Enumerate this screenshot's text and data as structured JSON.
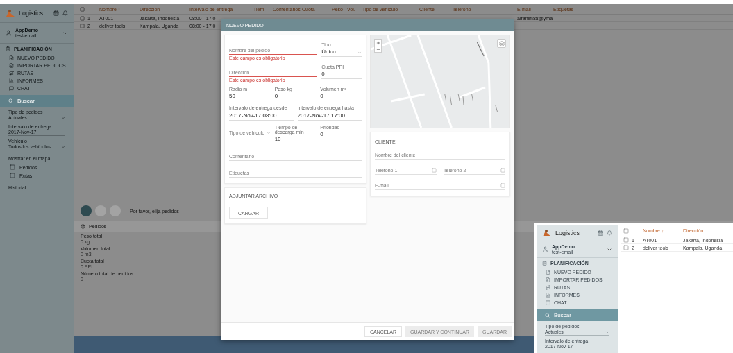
{
  "sidebar": {
    "brand": "Logistics",
    "user": {
      "name": "AppDemo",
      "sub": "test-email"
    },
    "section": "PLANIFICACIÓN",
    "items": [
      {
        "label": "NUEVO PEDIDO"
      },
      {
        "label": "IMPORTAR PEDIDOS"
      },
      {
        "label": "RUTAS"
      },
      {
        "label": "INFORMES"
      },
      {
        "label": "CHAT"
      }
    ],
    "search": "Buscar",
    "filters": [
      {
        "label": "Tipo de pedidos",
        "value": "Actuales",
        "kind": "select"
      },
      {
        "label": "Intervalo de entrega",
        "value": "2017-Nov-17",
        "kind": "date"
      },
      {
        "label": "Vehículo",
        "value": "Todos los vehículos",
        "kind": "select"
      }
    ],
    "map_options": {
      "title": "Mostrar en el mapa",
      "items": [
        {
          "label": "Pedidos",
          "checked": false
        },
        {
          "label": "Rutas",
          "checked": false
        }
      ]
    },
    "link": "Historial"
  },
  "table": {
    "header_checked": false,
    "columns": [
      "Nombre ↑",
      "Dirección",
      "Intervalo de entrega",
      "Tiem",
      "Comentarios",
      "Cuota",
      "Peso",
      "Vol.",
      "Tipo de vehículo",
      "Cliente",
      "Teléfono",
      "E-mail",
      "Etiquetas"
    ],
    "rows": [
      {
        "number": "1",
        "name": "AT001",
        "address": "Jakarta, Indonesia",
        "interval": "08:00 - 17:0",
        "email": "alrahim88@yma",
        "checked": false
      },
      {
        "number": "2",
        "name": "deliver tools",
        "address": "Kampala, Uganda",
        "interval": "08:00 - 17:0",
        "checked": false
      }
    ]
  },
  "steps": [
    {
      "selected": true
    },
    {
      "selected": false
    },
    {
      "selected": false
    }
  ],
  "steps_hint": "Por favor, elija pedidos",
  "panel": {
    "title": "Pedidos",
    "stats": [
      {
        "label": "Peso total",
        "value": "0 kg"
      },
      {
        "label": "Volumen total",
        "value": "0 m3"
      },
      {
        "label": "Cuota total",
        "value": "0 PPI"
      },
      {
        "label": "Número total de pedidos",
        "value": "0"
      }
    ]
  },
  "modal": {
    "title": "NUEVO PEDIDO",
    "rows": [
      {
        "kind": "wide",
        "fields": [
          {
            "kind": "input",
            "placeholder": "Nombre del pedido",
            "error": "Este campo es obligatorio"
          },
          {
            "kind": "select",
            "label": "Tipo",
            "value": "Único"
          }
        ]
      },
      {
        "kind": "wide",
        "fields": [
          {
            "kind": "input",
            "placeholder": "Dirección",
            "error": "Este campo es obligatorio"
          },
          {
            "kind": "input",
            "label": "Cuota PPI",
            "value": "0"
          }
        ]
      },
      {
        "kind": "even",
        "fields": [
          {
            "kind": "input",
            "label": "Radio m",
            "value": "50"
          },
          {
            "kind": "input",
            "label": "Peso kg",
            "value": "0"
          },
          {
            "kind": "input",
            "label": "Volumen m³",
            "value": "0"
          }
        ]
      },
      {
        "kind": "even",
        "fields": [
          {
            "kind": "input",
            "label": "Intervalo de entrega desde",
            "value": "2017-Nov-17 08:00"
          },
          {
            "kind": "input",
            "label": "Intervalo de entrega hasta",
            "value": "2017-Nov-17 17:00"
          }
        ]
      },
      {
        "kind": "even",
        "fields": [
          {
            "kind": "select",
            "placeholder": "Tipo de vehículo"
          },
          {
            "kind": "input",
            "label": "Tiempo de descarga min",
            "value": "10"
          },
          {
            "kind": "input",
            "label": "Prioridad",
            "value": "0"
          }
        ]
      },
      {
        "kind": "even",
        "fields": [
          {
            "kind": "input",
            "placeholder": "Comentario"
          }
        ]
      },
      {
        "kind": "even",
        "fields": [
          {
            "kind": "input",
            "placeholder": "Etiquetas"
          }
        ]
      }
    ],
    "attach": {
      "title": "ADJUNTAR ARCHIVO",
      "button": "CARGAR"
    },
    "client": {
      "title": "CLIENTE",
      "rows": [
        [
          {
            "placeholder": "Nombre del cliente"
          }
        ],
        [
          {
            "placeholder": "Teléfono 1",
            "checked": false
          },
          {
            "placeholder": "Teléfono 2",
            "checked": false
          }
        ],
        [
          {
            "placeholder": "E-mail",
            "checked": false
          }
        ]
      ]
    },
    "buttons": [
      {
        "label": "CANCELAR",
        "disabled": false
      },
      {
        "label": "GUARDAR Y CONTINUAR",
        "disabled": true
      },
      {
        "label": "GUARDAR",
        "disabled": true
      }
    ]
  },
  "inset": {
    "sidebar": {
      "brand": "Logistics",
      "user": {
        "name": "AppDemo",
        "sub": "test-email"
      },
      "section": "PLANIFICACIÓN",
      "items": [
        {
          "label": "NUEVO PEDIDO"
        },
        {
          "label": "IMPORTAR PEDIDOS"
        },
        {
          "label": "RUTAS"
        },
        {
          "label": "INFORMES"
        },
        {
          "label": "CHAT"
        }
      ],
      "search": "Buscar",
      "filters": [
        {
          "label": "Tipo de pedidos",
          "value": "Actuales",
          "kind": "select"
        },
        {
          "label": "Intervalo de entrega",
          "value": "2017-Nov-17",
          "kind": "date"
        }
      ]
    },
    "table": {
      "header_checked": false,
      "columns": [
        "Nombre ↑",
        "Dirección"
      ],
      "rows": [
        {
          "number": "1",
          "name": "AT001",
          "address": "Jakarta, Indonesia",
          "checked": false
        },
        {
          "number": "2",
          "name": "deliver tools",
          "address": "Kampala, Uganda",
          "checked": false
        }
      ]
    }
  }
}
